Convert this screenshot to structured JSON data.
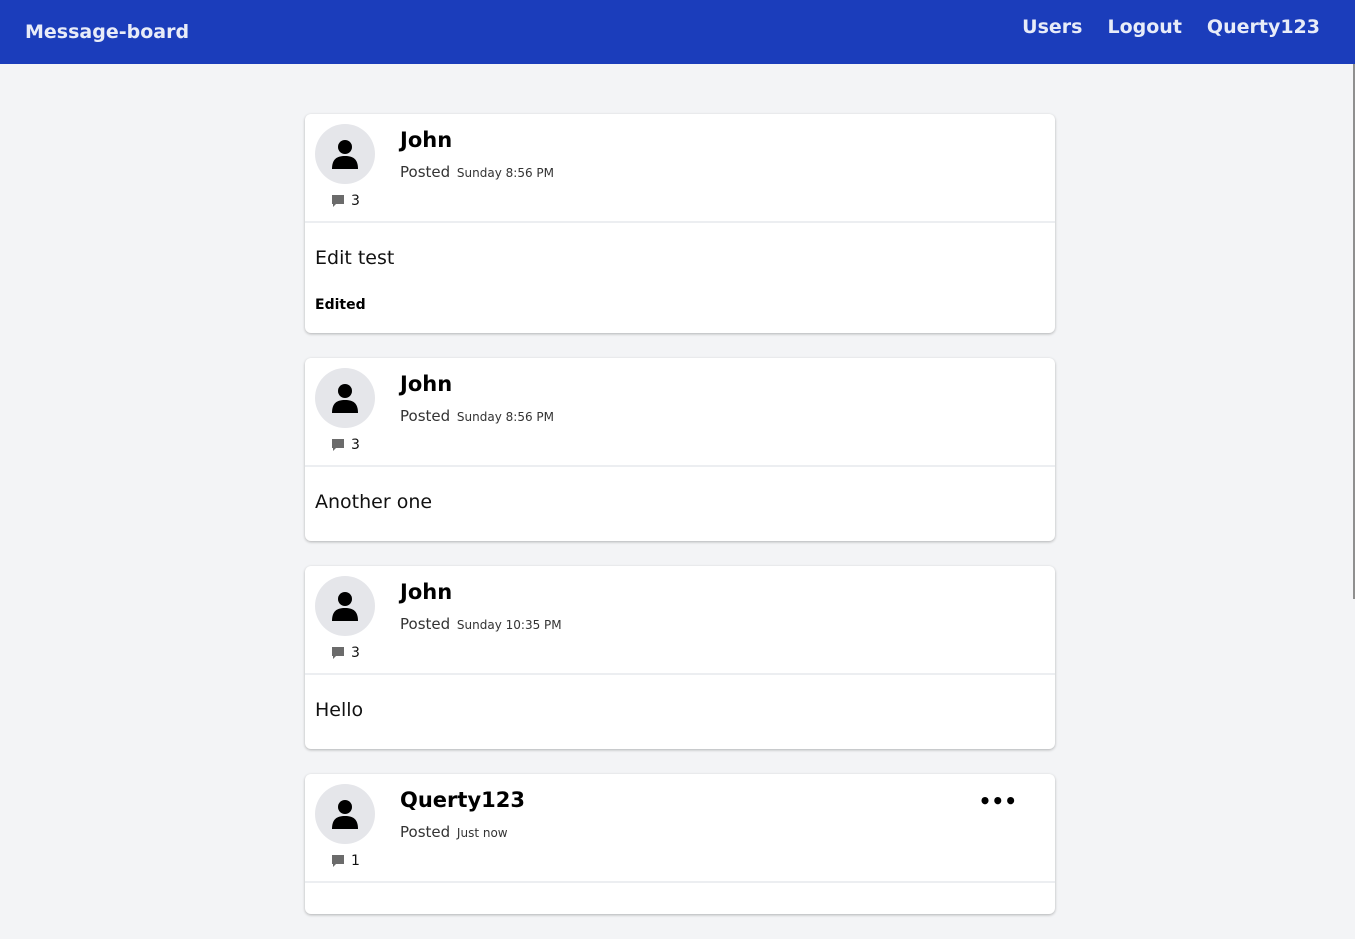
{
  "navbar": {
    "brand": "Message-board",
    "links": [
      "Users",
      "Logout",
      "Querty123"
    ],
    "background": "#1b3dbb"
  },
  "posts": [
    {
      "author": "John",
      "posted_label": "Posted",
      "time": "Sunday 8:56 PM",
      "comments": "3",
      "text": "Edit test",
      "edited_label": "Edited"
    },
    {
      "author": "John",
      "posted_label": "Posted",
      "time": "Sunday 8:56 PM",
      "comments": "3",
      "text": "Another one"
    },
    {
      "author": "John",
      "posted_label": "Posted",
      "time": "Sunday 10:35 PM",
      "comments": "3",
      "text": "Hello"
    },
    {
      "author": "Querty123",
      "posted_label": "Posted",
      "time": "Just now",
      "comments": "1",
      "more_label": "•••"
    }
  ],
  "icons": {
    "avatar": "user-icon",
    "comments": "comment-icon",
    "more": "ellipsis-icon"
  }
}
